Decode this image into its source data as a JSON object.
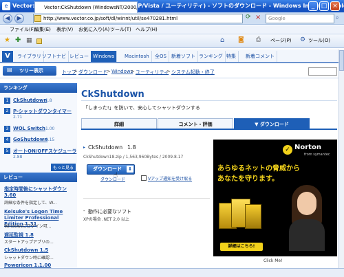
{
  "window": {
    "title": "Vector:CkShutdown (WindowsNT/2000/XP/Vista / ユーティリティ) - ソフトのダウンロード - Windows Internet Explorer",
    "icon": "ie-icon"
  },
  "address": {
    "url": "http://www.vector.co.jp/soft/dl/winnt/util/se470281.html",
    "search_placeholder": "Google"
  },
  "menu": [
    "ファイル(F)",
    "編集(E)",
    "表示(V)",
    "お気に入り(A)",
    "ツール(T)",
    "ヘルプ(H)"
  ],
  "browser_tab": {
    "label": "Vector:CkShutdown (WindowsNT/2000/XP/Vista /..."
  },
  "toolbar_right": {
    "page_label": "ページ(P)",
    "tools_label": "ツール(O)"
  },
  "site_nav": [
    "ライブラリ",
    "ソフトナビ",
    "レビュー",
    "Windows",
    "Macintosh",
    "全OS",
    "新着ソフト",
    "ランキング",
    "特集",
    "新着コメント"
  ],
  "crumbs": {
    "tree_label": "ツリー表示",
    "items": [
      "トップ",
      "ダウンロード",
      "Windows",
      "ユーティリティ",
      "システム起動・終了"
    ]
  },
  "sidebar": {
    "ranking_title": "ランキング",
    "ranking": [
      {
        "num": "1",
        "name": "CkShutdown",
        "count": "1.8"
      },
      {
        "num": "2",
        "name": "P-シャットダウンタイマー",
        "count": "2.71"
      },
      {
        "num": "3",
        "name": "WOL Switch",
        "count": "1.00"
      },
      {
        "num": "4",
        "name": "GoShutdown",
        "count": "0.15"
      },
      {
        "num": "5",
        "name": "オートON/OFFスケジューラ",
        "count": "2.88"
      }
    ],
    "more_label": "もっと見る",
    "review_title": "レビュー",
    "reviews": [
      {
        "name": "指定時間後にシャットダウン",
        "version": "3.60",
        "desc": "詳細な条件を指定して、W..."
      },
      {
        "name": "Keisuke's Logon Time Limiter Professional Edition",
        "version": "1.31",
        "desc": "Windowsにログイン可..."
      },
      {
        "name": "遅延監視",
        "version": "1.8",
        "desc": "スタートアップアプリの..."
      },
      {
        "name": "CkShutdown",
        "version": "1.5",
        "desc": "シャットダウン時に確認..."
      },
      {
        "name": "Powericon",
        "version": "1.1.00",
        "desc": ""
      }
    ]
  },
  "main": {
    "title": "CkShutdown",
    "subtitle": "「しまった!」を防いで、安心してシャットダウンする",
    "tabs": [
      "詳細",
      "コメント・評価",
      "ダウンロード"
    ],
    "file_name": "CkShutdown",
    "file_version": "1.8",
    "file_info": "CkShutdown18.zip / 1,563,960Bytes / 2009.8.17",
    "download_button": "ダウンロード",
    "download_link": "ダウンロード",
    "notify_label": "Vアップ通知を受け取る",
    "req_title": "動作に必要なソフト",
    "req_text": "XPの場合 .NET 2.0 以上"
  },
  "ad": {
    "brand": "Norton",
    "brand_sub": "from symantec",
    "headline1": "あらゆるネットの脅威から",
    "headline2": "あなたを守ります。",
    "cta": "詳細はこちら!",
    "click_label": "Click Me!"
  },
  "colors": {
    "accent": "#1e5fb7",
    "title_bar": "#1756c6",
    "ad_text": "#f2d21b"
  }
}
